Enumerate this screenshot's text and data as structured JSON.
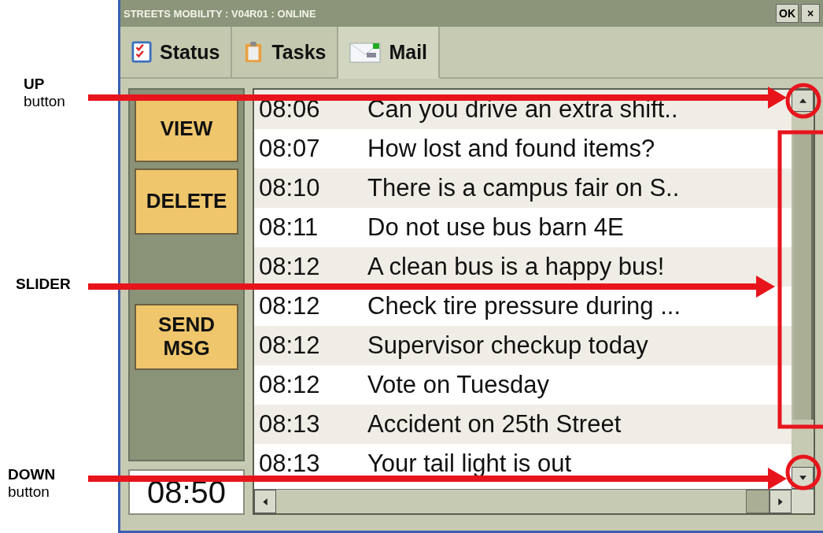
{
  "window": {
    "title": "STREETS MOBILITY : V04R01 : ONLINE",
    "buttons": [
      "OK",
      "×"
    ]
  },
  "tabs": [
    {
      "label": "Status",
      "selected": false
    },
    {
      "label": "Tasks",
      "selected": false
    },
    {
      "label": "Mail",
      "selected": true
    }
  ],
  "actions": [
    "VIEW",
    "DELETE",
    "SEND MSG"
  ],
  "clock": "08:50",
  "messages": [
    {
      "time": "08:06",
      "text": "Can you drive an extra shift.."
    },
    {
      "time": "08:07",
      "text": "How lost and found items?"
    },
    {
      "time": "08:10",
      "text": "There is a campus fair on S.."
    },
    {
      "time": "08:11",
      "text": "Do not use bus barn 4E"
    },
    {
      "time": "08:12",
      "text": "A clean bus is a happy bus!"
    },
    {
      "time": "08:12",
      "text": "Check tire pressure during ..."
    },
    {
      "time": "08:12",
      "text": "Supervisor checkup today"
    },
    {
      "time": "08:12",
      "text": "Vote on Tuesday"
    },
    {
      "time": "08:13",
      "text": "Accident on 25th Street"
    },
    {
      "time": "08:13",
      "text": "Your tail light is out"
    }
  ],
  "annotations": [
    {
      "label": "UP",
      "sublabel": "button",
      "kind": "circle"
    },
    {
      "label": "SLIDER",
      "kind": "frame"
    },
    {
      "label": "DOWN",
      "sublabel": "button",
      "kind": "circle"
    }
  ]
}
